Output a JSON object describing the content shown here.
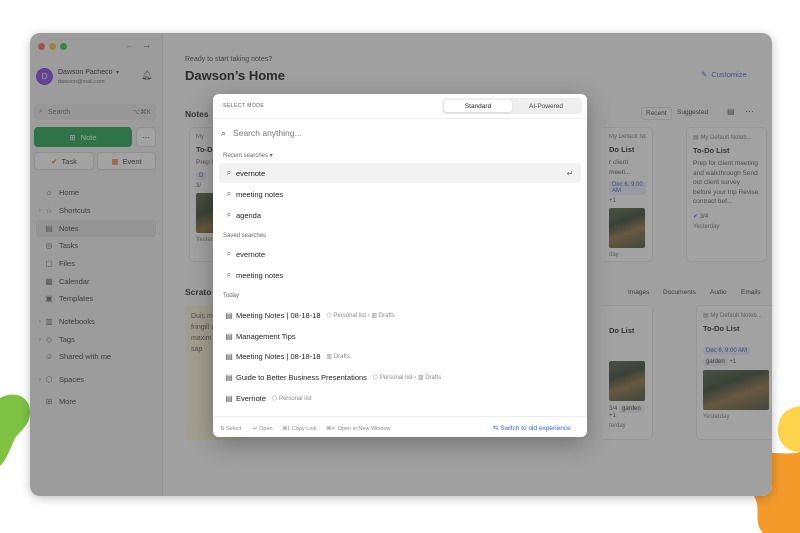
{
  "colors": {
    "accent": "#3a61d9",
    "primary_green": "#16a34a",
    "blob_green": "#7ec243",
    "blob_yellow": "#fdd34a",
    "blob_orange": "#f39a2a"
  },
  "sidebar": {
    "user_name": "Dawson Pacheco",
    "user_email": "dawson@mail.com",
    "avatar_initial": "D",
    "search_placeholder": "Search",
    "search_shortcut": "⌥⌘K",
    "note_button": "Note",
    "task_button": "Task",
    "event_button": "Event",
    "nav": [
      {
        "label": "Home"
      },
      {
        "label": "Shortcuts"
      },
      {
        "label": "Notes"
      },
      {
        "label": "Tasks"
      },
      {
        "label": "Files"
      },
      {
        "label": "Calendar"
      },
      {
        "label": "Templates"
      },
      {
        "label": "Notebooks"
      },
      {
        "label": "Tags"
      },
      {
        "label": "Shared with me"
      },
      {
        "label": "Spaces"
      },
      {
        "label": "More"
      }
    ]
  },
  "main": {
    "subtitle": "Ready to start taking notes?",
    "title": "Dawson’s Home",
    "customize": "Customize",
    "notes_heading": "Notes",
    "recent": "Recent",
    "suggested": "Suggested",
    "scratch_heading": "Scrato",
    "scratch_text": "Duis m varius fringill aliqua maxim purus et sap",
    "filters": {
      "images": "Images",
      "documents": "Documents",
      "audio": "Audio",
      "emails": "Emails"
    },
    "left_card": {
      "notebook": "My",
      "title": "To-Do",
      "body": "Prep f",
      "chip": "D",
      "count": "3/",
      "date": "Yester"
    },
    "right_cards": [
      {
        "notebook": "My Default Noteb...",
        "title": "To-Do List",
        "body": "Prep for client meeting and walkthrough Send out client survey before your trip Revise contract bef...",
        "count": "3/4",
        "date": "Yesterday"
      }
    ],
    "mid_card": {
      "notebook": "My Default Noteb...",
      "title": "Do List",
      "body": "r client meeti...",
      "chip": "Dec 6, 9:00 AM",
      "plus": "+1",
      "date": "day"
    },
    "lower_card": {
      "notebook": "My Default Noteb...",
      "title": "To-Do List",
      "chip": "Dec 6, 9:00 AM",
      "tag": "garden",
      "plus": "+1",
      "date": "Yesterday"
    },
    "lower_mid": {
      "title": "Do List",
      "count": "3/4",
      "tag": "garden",
      "plus": "+1",
      "date": "terday"
    }
  },
  "modal": {
    "mode_label": "SELECT MODE",
    "mode_standard": "Standard",
    "mode_ai": "AI-Powered",
    "search_placeholder": "Search anything...",
    "recent_label": "Recent searches",
    "recent": [
      "evernote",
      "meeting notes",
      "agenda"
    ],
    "saved_label": "Saved searches",
    "saved": [
      "evernote",
      "meeting notes"
    ],
    "today_label": "Today",
    "results": [
      {
        "title": "Meeting Notes | 08-18-18",
        "space": "Personal list",
        "notebook": "Drafts"
      },
      {
        "title": "Management Tips",
        "space": "",
        "notebook": ""
      },
      {
        "title": "Meeting Notes | 08-18-18",
        "space": "",
        "notebook": "Drafts"
      },
      {
        "title": "Guide to Better Business Presentations",
        "space": "Personal list",
        "notebook": "Drafts"
      },
      {
        "title": "Evernote",
        "space": "Personal list",
        "notebook": ""
      }
    ],
    "hints": {
      "select": "Select",
      "open": "Open",
      "copy": "Copy Link",
      "new_window": "Open in New Window"
    },
    "switch_old": "Switch to old experience"
  }
}
